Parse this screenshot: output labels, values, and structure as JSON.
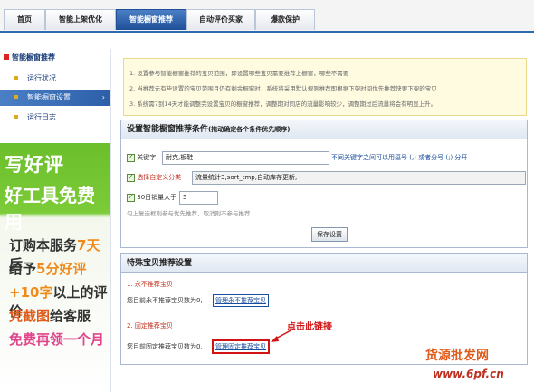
{
  "topnav": {
    "tabs": [
      {
        "label": "首页"
      },
      {
        "label": "智能上架优化"
      },
      {
        "label": "智能橱窗推荐"
      },
      {
        "label": "自动评价买家"
      },
      {
        "label": "爆款保护"
      }
    ],
    "active_index": 2
  },
  "sidebar": {
    "title": "智能橱窗推荐",
    "items": [
      {
        "label": "运行状况"
      },
      {
        "label": "智能橱窗设置"
      },
      {
        "label": "运行日志"
      }
    ],
    "active_index": 1,
    "arrow": "›"
  },
  "ad": {
    "line1": "写好评",
    "line2": "好工具免费用",
    "line3a": "订购本服务",
    "line3b": "7天",
    "line3c": "后",
    "line4a": "给予",
    "line4b": "5分好评",
    "line5a": "+10字",
    "line5b": "以上的评价",
    "line6a": "凭截图",
    "line6b": "给客服",
    "line7": "免费再领一个月"
  },
  "tips": {
    "line1": "1. 设置参与智能橱窗推荐的宝贝范围，即设置哪些宝贝需要推荐上橱窗，哪些不需要",
    "line2": "2. 当推荐元有些设置的宝贝范围且仍有剩余橱窗时，系统将采用默认规则推荐即根据下架时间优先推荐快要下架的宝贝",
    "line3": "3. 系统需7到14天才能调整完设置宝贝的橱窗推荐，调整期对同店的流量影响较少，调整期过后流量将会有明显上升。"
  },
  "conditions": {
    "title": "设置智能橱窗推荐条件",
    "title_note": "(拖动确定各个条件优先顺序)",
    "keyword_label": "关键字",
    "keyword_value": "耐克,板鞋",
    "keyword_hint": "不同关键字之间可以用逗号 (,) 或者分号 (;) 分开",
    "category_label": "选择自定义分类",
    "category_value": "流量统计3,sort_tmp,自动库存更新,",
    "sales_label": "30日销量大于",
    "sales_value": "5",
    "note": "勾上复选框则参与优先推荐，取消则不参与推荐",
    "save_button": "保存设置"
  },
  "special": {
    "title": "特殊宝贝推荐设置",
    "never_title": "1. 永不推荐宝贝",
    "never_text": "您目前永不推荐宝贝数为0,",
    "never_link": "管理永不推荐宝贝",
    "fixed_title": "2. 固定推荐宝贝",
    "fixed_text": "您目前固定推荐宝贝数为0,",
    "fixed_link": "管理固定推荐宝贝",
    "callout": "点击此链接"
  },
  "watermark": {
    "brand": "货源批发网",
    "url": "www.6pf.cn"
  }
}
